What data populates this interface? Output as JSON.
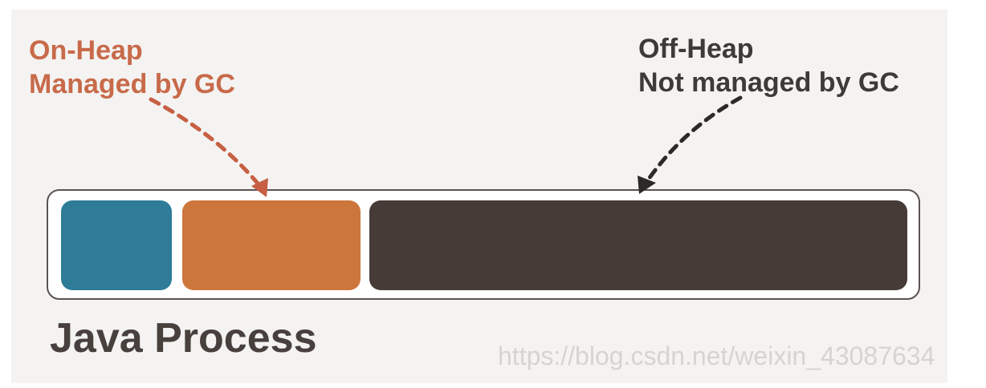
{
  "on_heap": {
    "line1": "On-Heap",
    "line2": "Managed by GC"
  },
  "off_heap": {
    "line1": "Off-Heap",
    "line2": "Not managed by GC"
  },
  "process": {
    "title": "Java Process"
  },
  "watermark": {
    "text": "https://blog.csdn.net/weixin_43087634"
  },
  "colors": {
    "on_heap_label": "#c86a4a",
    "off_heap_label": "#3e3a38",
    "title": "#47403d",
    "block_blue": "#2e7c98",
    "block_orange": "#cd763c",
    "block_dark": "#463b37",
    "arrow_on_heap": "#c65f43",
    "arrow_off_heap": "#2c2927"
  }
}
